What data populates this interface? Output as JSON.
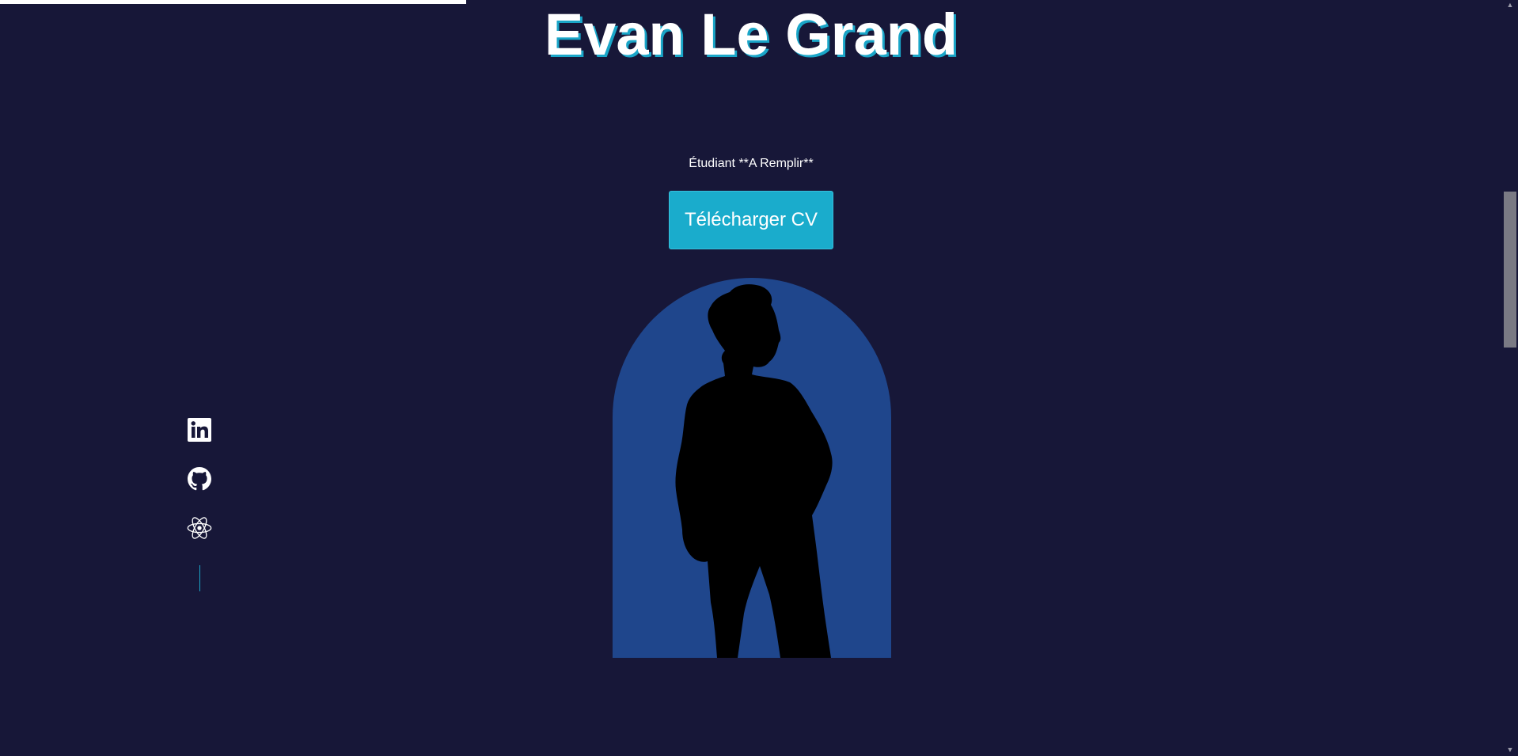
{
  "header": {
    "title": "Evan Le Grand"
  },
  "hero": {
    "subtitle": "Étudiant **A Remplir**",
    "cv_button_label": "Télécharger CV",
    "portrait_alt": "silhouette"
  },
  "reading_progress": 0.307,
  "socials": [
    {
      "name": "linkedin",
      "icon": "linkedin-icon"
    },
    {
      "name": "github",
      "icon": "github-icon"
    },
    {
      "name": "react",
      "icon": "react-icon"
    }
  ],
  "colors": {
    "background": "#171738",
    "accent": "#1aaccc",
    "arch": "#1f468c",
    "text": "#ffffff"
  }
}
